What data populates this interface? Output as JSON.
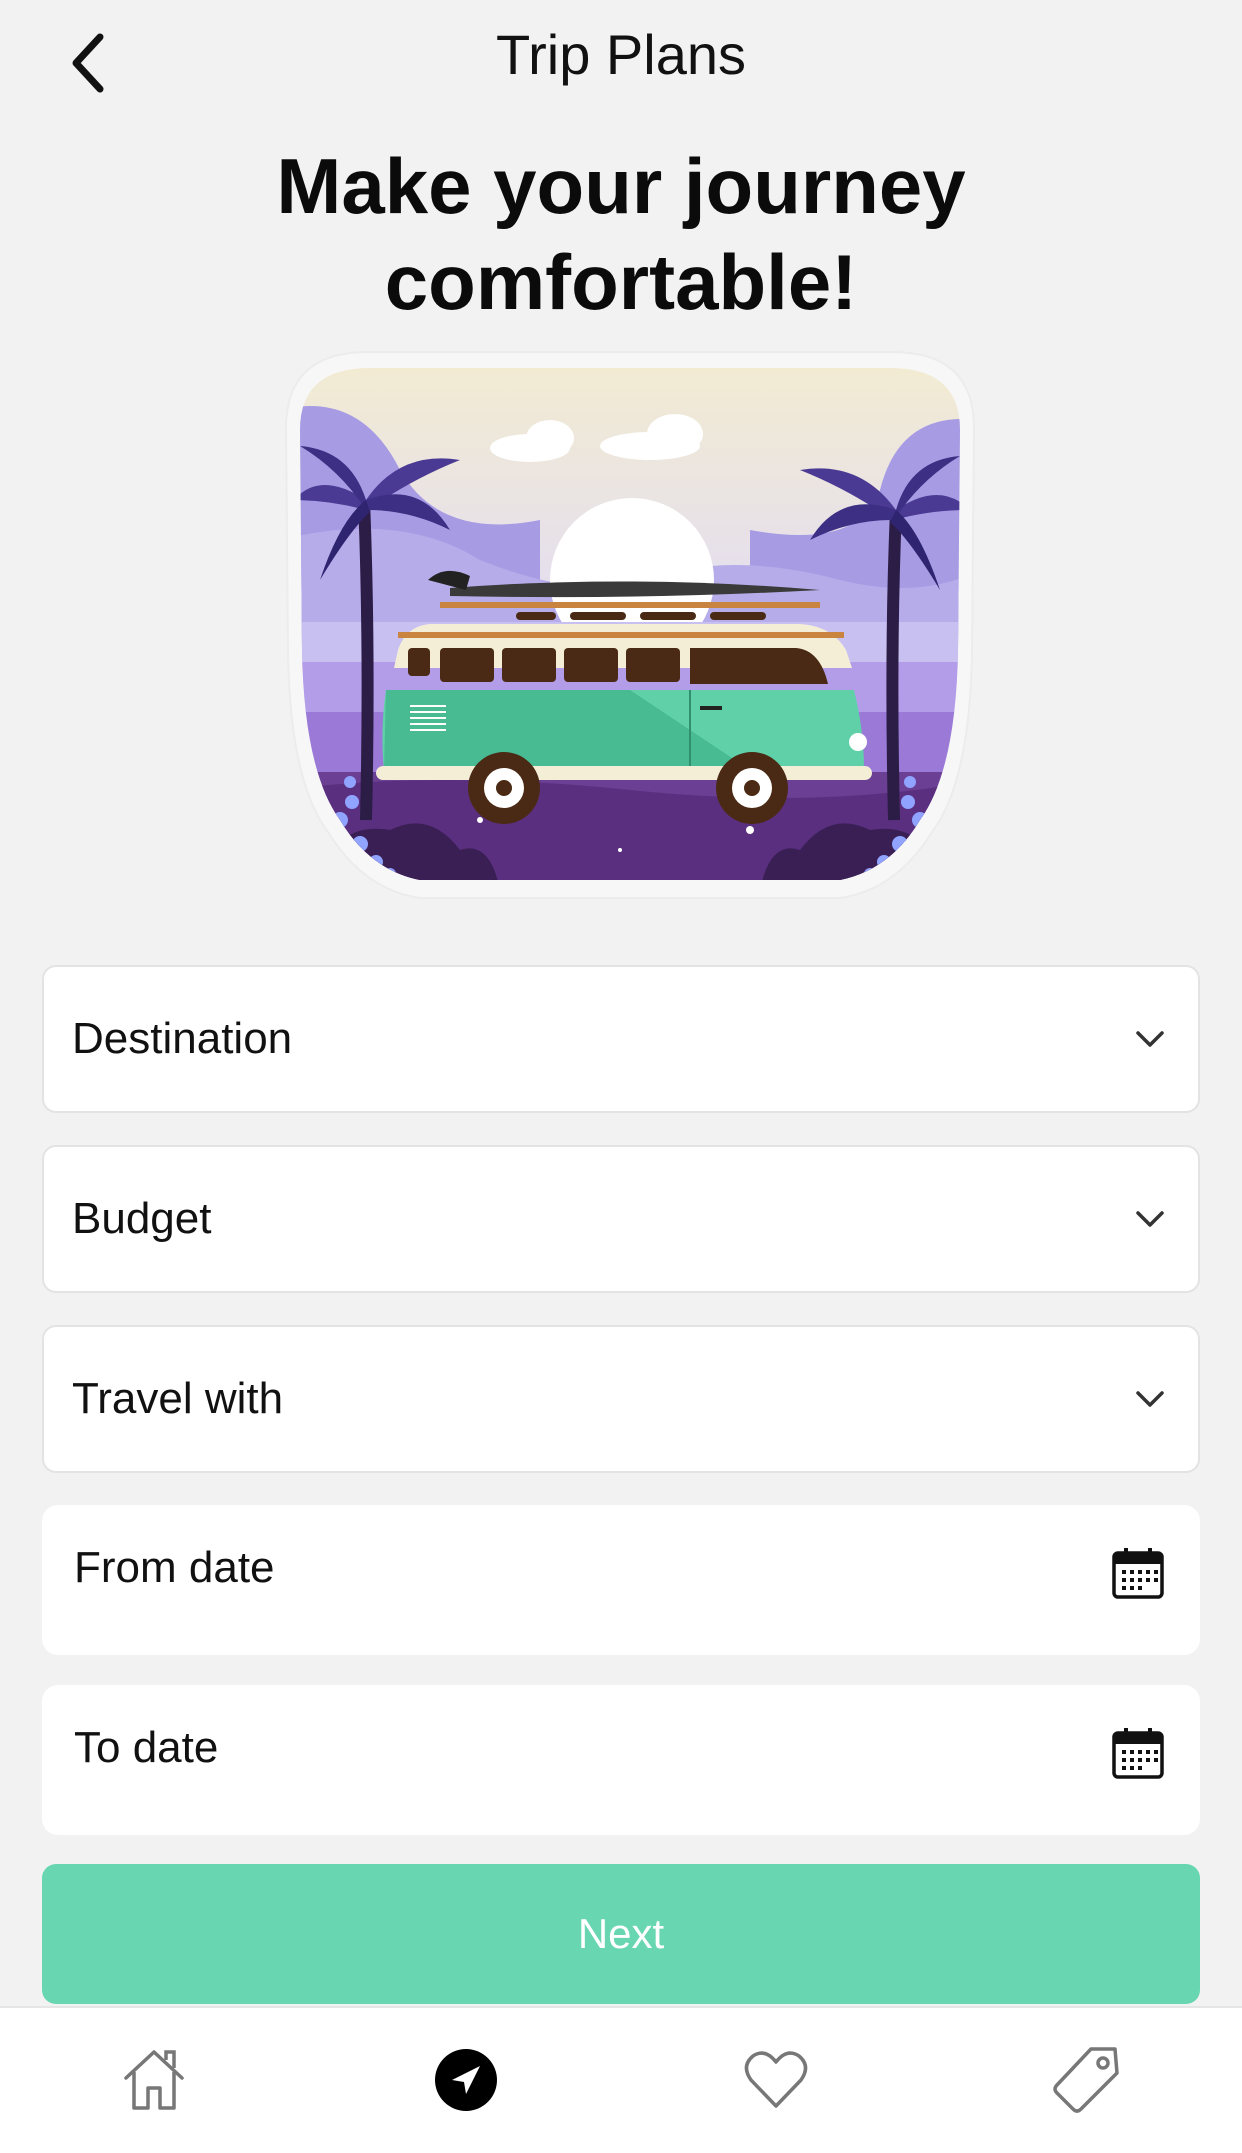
{
  "header": {
    "title": "Trip Plans",
    "back_icon": "chevron-left-icon"
  },
  "hero": {
    "headline_line1": "Make your journey",
    "headline_line2": "comfortable!"
  },
  "form": {
    "destination_label": "Destination",
    "budget_label": "Budget",
    "travel_with_label": "Travel with",
    "from_date_label": "From date",
    "to_date_label": "To date"
  },
  "actions": {
    "next_label": "Next"
  },
  "tabbar": {
    "items": [
      {
        "icon": "home-icon",
        "active": false
      },
      {
        "icon": "navigation-arrow-icon",
        "active": true
      },
      {
        "icon": "heart-icon",
        "active": false
      },
      {
        "icon": "tag-icon",
        "active": false
      }
    ]
  },
  "colors": {
    "accent": "#68d6b1",
    "background": "#f2f2f2",
    "surface": "#ffffff"
  }
}
